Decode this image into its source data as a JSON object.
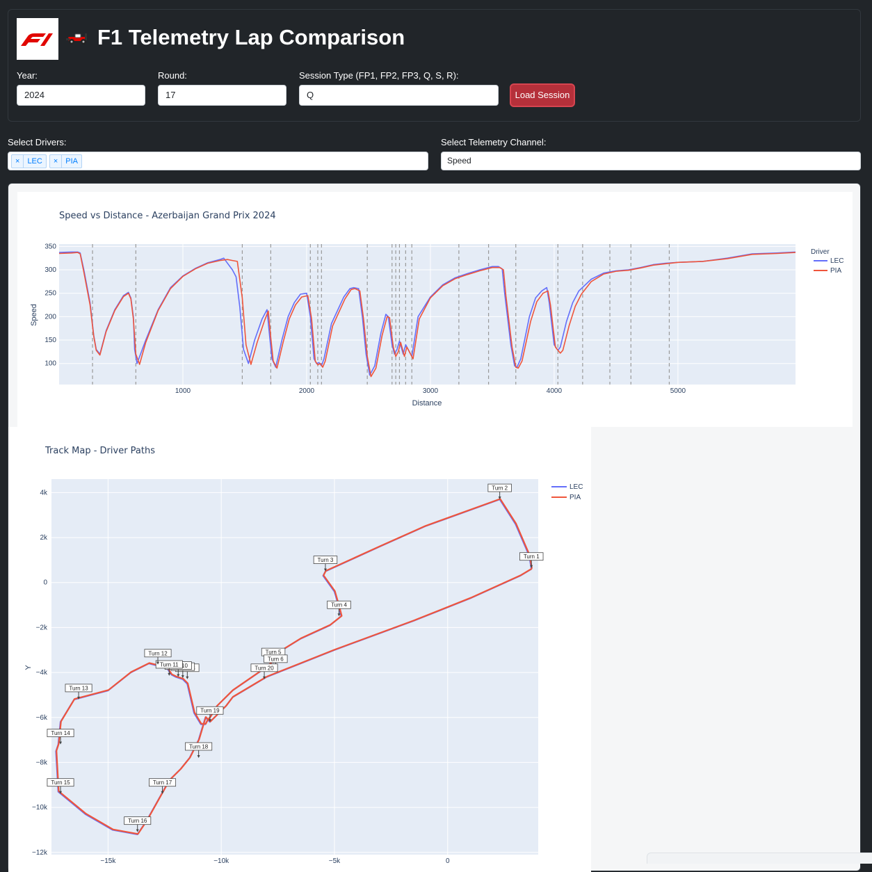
{
  "header": {
    "logo_text": "F1",
    "title": "F1 Telemetry Lap Comparison",
    "year_label": "Year:",
    "year_value": "2024",
    "round_label": "Round:",
    "round_value": "17",
    "session_label": "Session Type (FP1, FP2, FP3, Q, S, R):",
    "session_value": "Q",
    "load_button": "Load Session"
  },
  "controls": {
    "drivers_label": "Select Drivers:",
    "drivers": [
      {
        "remove": "×",
        "label": "LEC"
      },
      {
        "remove": "×",
        "label": "PIA"
      }
    ],
    "channel_label": "Select Telemetry Channel:",
    "channel_value": "Speed"
  },
  "colors": {
    "LEC": "#636efa",
    "PIA": "#ef553b",
    "plot_bg": "#e5ecf6",
    "accent": "#b5303a"
  },
  "chart_data": [
    {
      "type": "line",
      "title": "Speed vs Distance - Azerbaijan Grand Prix 2024",
      "xlabel": "Distance",
      "ylabel": "Speed",
      "xlim": [
        0,
        5950
      ],
      "ylim": [
        55,
        355
      ],
      "x_ticks": [
        1000,
        2000,
        3000,
        4000,
        5000
      ],
      "y_ticks": [
        100,
        150,
        200,
        250,
        300,
        350
      ],
      "legend_title": "Driver",
      "legend_position": "top-right",
      "corner_markers_x": [
        270,
        620,
        1480,
        1710,
        2030,
        2090,
        2120,
        2490,
        2690,
        2720,
        2750,
        2800,
        2850,
        3230,
        3470,
        3690,
        4030,
        4230,
        4450,
        4620,
        4930
      ],
      "series": [
        {
          "name": "LEC",
          "x": [
            0,
            100,
            150,
            170,
            200,
            250,
            280,
            300,
            330,
            380,
            450,
            520,
            560,
            580,
            600,
            610,
            630,
            700,
            800,
            900,
            1000,
            1100,
            1200,
            1300,
            1330,
            1400,
            1430,
            1460,
            1490,
            1530,
            1580,
            1640,
            1680,
            1700,
            1720,
            1750,
            1800,
            1850,
            1900,
            1950,
            2000,
            2030,
            2060,
            2080,
            2100,
            2120,
            2140,
            2200,
            2300,
            2350,
            2380,
            2420,
            2450,
            2480,
            2510,
            2550,
            2600,
            2640,
            2660,
            2690,
            2710,
            2730,
            2750,
            2780,
            2800,
            2850,
            2900,
            3000,
            3100,
            3200,
            3300,
            3400,
            3500,
            3550,
            3580,
            3600,
            3650,
            3680,
            3700,
            3730,
            3800,
            3850,
            3900,
            3940,
            3960,
            4000,
            4030,
            4050,
            4100,
            4150,
            4200,
            4300,
            4400,
            4500,
            4600,
            4700,
            4800,
            4900,
            5000,
            5200,
            5400,
            5600,
            5800,
            5950
          ],
          "y": [
            337,
            338,
            338,
            336,
            300,
            230,
            160,
            130,
            120,
            170,
            215,
            245,
            252,
            240,
            200,
            130,
            100,
            150,
            215,
            262,
            287,
            303,
            315,
            322,
            325,
            300,
            285,
            220,
            130,
            100,
            150,
            195,
            215,
            160,
            110,
            92,
            150,
            200,
            230,
            248,
            250,
            200,
            110,
            100,
            102,
            95,
            110,
            185,
            242,
            260,
            262,
            260,
            200,
            120,
            75,
            95,
            165,
            205,
            200,
            140,
            120,
            130,
            148,
            120,
            140,
            115,
            200,
            242,
            268,
            283,
            292,
            300,
            307,
            307,
            302,
            250,
            140,
            95,
            92,
            110,
            200,
            240,
            255,
            262,
            230,
            140,
            128,
            135,
            190,
            230,
            255,
            280,
            293,
            298,
            300,
            305,
            311,
            314,
            316,
            318,
            325,
            334,
            336,
            338
          ]
        },
        {
          "name": "PIA",
          "x": [
            0,
            100,
            150,
            170,
            200,
            250,
            280,
            300,
            330,
            380,
            450,
            520,
            560,
            580,
            600,
            620,
            650,
            700,
            800,
            900,
            1000,
            1100,
            1200,
            1300,
            1360,
            1400,
            1440,
            1480,
            1510,
            1550,
            1600,
            1660,
            1690,
            1710,
            1730,
            1760,
            1810,
            1860,
            1910,
            1960,
            2010,
            2040,
            2070,
            2090,
            2110,
            2130,
            2150,
            2210,
            2310,
            2360,
            2390,
            2430,
            2460,
            2490,
            2520,
            2560,
            2610,
            2650,
            2670,
            2700,
            2720,
            2740,
            2760,
            2790,
            2810,
            2860,
            2910,
            3000,
            3100,
            3200,
            3300,
            3400,
            3500,
            3560,
            3590,
            3610,
            3660,
            3690,
            3710,
            3740,
            3810,
            3860,
            3910,
            3950,
            3970,
            4010,
            4050,
            4070,
            4120,
            4170,
            4220,
            4300,
            4400,
            4500,
            4600,
            4700,
            4800,
            4900,
            5000,
            5200,
            5400,
            5600,
            5800,
            5950
          ],
          "y": [
            335,
            336,
            337,
            334,
            295,
            225,
            158,
            128,
            118,
            168,
            213,
            243,
            250,
            238,
            195,
            120,
            98,
            145,
            213,
            260,
            286,
            302,
            314,
            320,
            322,
            320,
            318,
            240,
            140,
            98,
            145,
            192,
            212,
            155,
            105,
            90,
            145,
            195,
            225,
            242,
            245,
            195,
            105,
            97,
            100,
            92,
            105,
            180,
            238,
            258,
            260,
            255,
            195,
            115,
            72,
            90,
            160,
            200,
            198,
            135,
            115,
            125,
            145,
            115,
            135,
            110,
            195,
            240,
            266,
            281,
            290,
            298,
            305,
            305,
            300,
            245,
            135,
            92,
            90,
            105,
            190,
            232,
            250,
            255,
            225,
            135,
            122,
            128,
            180,
            222,
            248,
            275,
            291,
            297,
            299,
            304,
            310,
            313,
            316,
            318,
            324,
            333,
            335,
            337
          ]
        }
      ]
    },
    {
      "type": "line",
      "title": "Track Map - Driver Paths",
      "xlabel": "",
      "ylabel": "Y",
      "xlim": [
        -17500,
        4000
      ],
      "ylim": [
        -12100,
        4600
      ],
      "x_ticks": [
        -15000,
        -10000,
        -5000,
        0
      ],
      "x_tick_labels": [
        "−15k",
        "−10k",
        "−5k",
        "0"
      ],
      "y_ticks": [
        4000,
        2000,
        0,
        -2000,
        -4000,
        -6000,
        -8000,
        -10000,
        -12000
      ],
      "y_tick_labels": [
        "4k",
        "2k",
        "0",
        "−2k",
        "−4k",
        "−6k",
        "−8k",
        "−10k",
        "−12k"
      ],
      "legend_position": "top-right",
      "series": [
        {
          "name": "LEC",
          "x": [
            3700,
            3600,
            3000,
            2300,
            -1000,
            -3000,
            -5400,
            -5500,
            -5000,
            -4800,
            -4700,
            -5200,
            -6500,
            -7300,
            -7700,
            -8200,
            -9500,
            -10200,
            -10500,
            -10600,
            -10700,
            -10900,
            -11200,
            -11500,
            -11700,
            -12000,
            -12200,
            -12400,
            -12800,
            -13200,
            -14000,
            -15000,
            -16500,
            -17100,
            -17200,
            -17300,
            -17200,
            -16000,
            -14800,
            -13700,
            -13300,
            -12800,
            -12300,
            -11800,
            -11400,
            -11000,
            -10700,
            -10500,
            -10200,
            -9800,
            -9500,
            -8000,
            -5000,
            -1500,
            1000,
            3200,
            3700
          ],
          "y": [
            600,
            1200,
            2600,
            3700,
            2500,
            1600,
            500,
            300,
            -400,
            -1100,
            -1500,
            -1900,
            -2500,
            -3000,
            -3500,
            -3900,
            -4800,
            -5500,
            -6000,
            -6100,
            -6300,
            -6300,
            -5800,
            -4500,
            -4300,
            -4200,
            -4100,
            -3800,
            -3700,
            -3600,
            -4000,
            -4800,
            -5200,
            -6200,
            -7200,
            -7500,
            -9300,
            -10300,
            -11000,
            -11200,
            -10600,
            -9700,
            -8800,
            -8300,
            -7800,
            -7000,
            -6000,
            -6200,
            -5900,
            -5500,
            -5100,
            -4200,
            -3000,
            -1700,
            -700,
            300,
            600
          ]
        },
        {
          "name": "PIA",
          "x": [
            3720,
            3620,
            3020,
            2320,
            -980,
            -2980,
            -5380,
            -5480,
            -4980,
            -4780,
            -4680,
            -5180,
            -6480,
            -7280,
            -7680,
            -8180,
            -9480,
            -10180,
            -10480,
            -10580,
            -10680,
            -10880,
            -11180,
            -11480,
            -11680,
            -11980,
            -12180,
            -12380,
            -12780,
            -13180,
            -13980,
            -14980,
            -16480,
            -17080,
            -17180,
            -17280,
            -17180,
            -15980,
            -14780,
            -13680,
            -13280,
            -12780,
            -12280,
            -11780,
            -11380,
            -10980,
            -10680,
            -10480,
            -10180,
            -9780,
            -9480,
            -7980,
            -4980,
            -1480,
            1020,
            3220,
            3720
          ],
          "y": [
            620,
            1220,
            2620,
            3720,
            2520,
            1620,
            520,
            320,
            -380,
            -1080,
            -1480,
            -1880,
            -2480,
            -2980,
            -3480,
            -3880,
            -4780,
            -5480,
            -5980,
            -6080,
            -6280,
            -6280,
            -5780,
            -4480,
            -4280,
            -4180,
            -4080,
            -3780,
            -3680,
            -3580,
            -3980,
            -4780,
            -5180,
            -6180,
            -7180,
            -7480,
            -9280,
            -10280,
            -10980,
            -11180,
            -10580,
            -9680,
            -8780,
            -8280,
            -7780,
            -6980,
            -5980,
            -6180,
            -5880,
            -5480,
            -5080,
            -4180,
            -2980,
            -1680,
            -680,
            320,
            620
          ]
        }
      ],
      "annotations": [
        {
          "text": "Turn 1",
          "x": 3700,
          "y": 650
        },
        {
          "text": "Turn 2",
          "x": 2300,
          "y": 3700
        },
        {
          "text": "Turn 3",
          "x": -5400,
          "y": 500
        },
        {
          "text": "Turn 4",
          "x": -4800,
          "y": -1500
        },
        {
          "text": "Turn 5",
          "x": -7700,
          "y": -3600
        },
        {
          "text": "Turn 6",
          "x": -7600,
          "y": -3900
        },
        {
          "text": "Turn 8",
          "x": -11500,
          "y": -4300
        },
        {
          "text": "Turn 9",
          "x": -11700,
          "y": -4250
        },
        {
          "text": "Turn 10",
          "x": -11900,
          "y": -4200
        },
        {
          "text": "Turn 11",
          "x": -12300,
          "y": -4150
        },
        {
          "text": "Turn 12",
          "x": -12800,
          "y": -3650
        },
        {
          "text": "Turn 13",
          "x": -16300,
          "y": -5200
        },
        {
          "text": "Turn 14",
          "x": -17100,
          "y": -7200
        },
        {
          "text": "Turn 15",
          "x": -17100,
          "y": -9400
        },
        {
          "text": "Turn 16",
          "x": -13700,
          "y": -11100
        },
        {
          "text": "Turn 17",
          "x": -12600,
          "y": -9400
        },
        {
          "text": "Turn 18",
          "x": -11000,
          "y": -7800
        },
        {
          "text": "Turn 19",
          "x": -10500,
          "y": -6200
        },
        {
          "text": "Turn 20",
          "x": -8100,
          "y": -4300
        }
      ]
    }
  ]
}
